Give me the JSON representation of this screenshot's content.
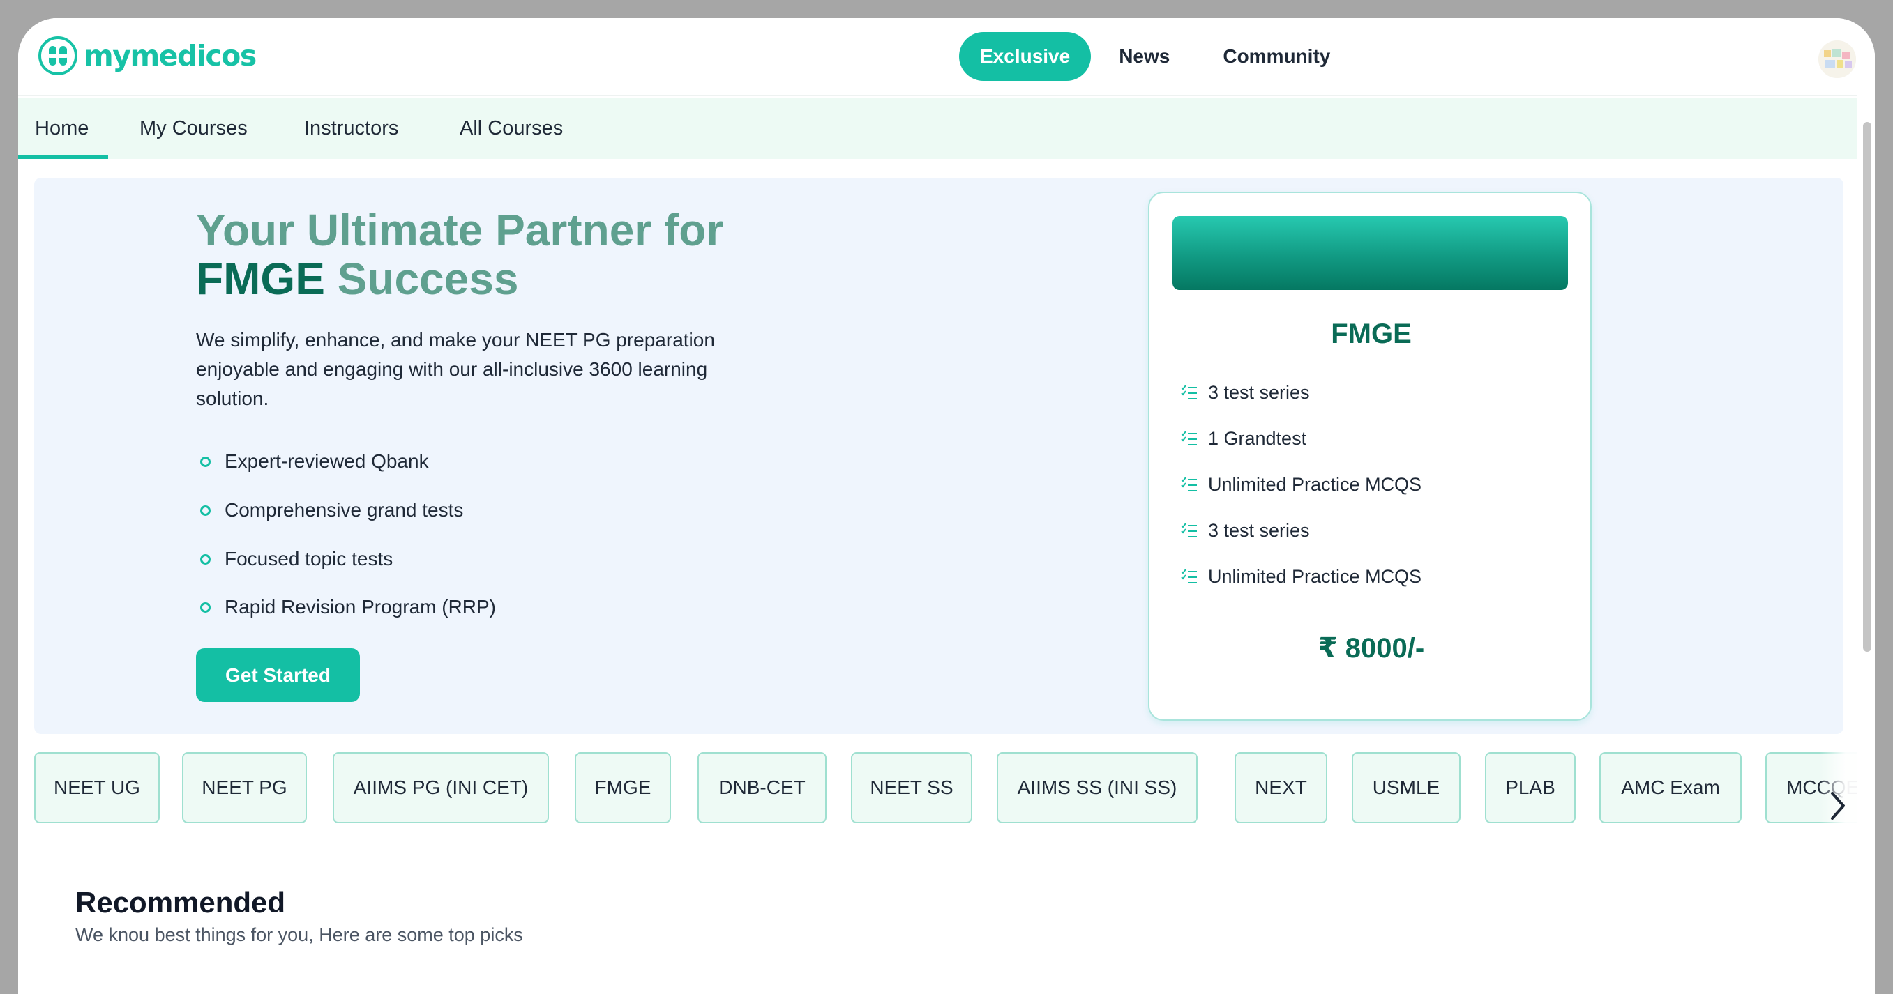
{
  "brand": {
    "name": "mymedicos",
    "color": "#17c2a6"
  },
  "top_nav": [
    {
      "label": "Exclusive",
      "active": true
    },
    {
      "label": "News",
      "active": false
    },
    {
      "label": "Community",
      "active": false
    }
  ],
  "sub_nav": [
    {
      "label": "Home",
      "active": true
    },
    {
      "label": "My Courses",
      "active": false
    },
    {
      "label": "Instructors",
      "active": false
    },
    {
      "label": "All Courses",
      "active": false
    }
  ],
  "hero": {
    "title_line1": "Your Ultimate Partner for",
    "title_em": "FMGE",
    "title_rest": " Success",
    "description": "We simplify, enhance, and make your NEET PG preparation enjoyable and engaging with our all-inclusive 3600 learning solution.",
    "features": [
      "Expert-reviewed Qbank",
      "Comprehensive grand tests",
      "Focused topic tests",
      "Rapid Revision Program (RRP)"
    ],
    "cta_label": "Get Started"
  },
  "plan": {
    "title": "FMGE",
    "items": [
      "3 test series",
      "1 Grandtest",
      "Unlimited Practice MCQS",
      "3 test series",
      "Unlimited Practice MCQS"
    ],
    "price": "₹ 8000/-"
  },
  "exam_chips": [
    "NEET UG",
    "NEET PG",
    "AIIMS PG (INI CET)",
    "FMGE",
    "DNB-CET",
    "NEET SS",
    "AIIMS SS (INI SS)",
    "NEXT",
    "USMLE",
    "PLAB",
    "AMC Exam",
    "MCCQE"
  ],
  "recommended": {
    "title": "Recommended",
    "subtitle": "We knou best things for you, Here are some top picks"
  },
  "colors": {
    "accent": "#14bfa4",
    "dark_green": "#0a6b56",
    "hero_bg": "#eff5fd",
    "subnav_bg": "#edfaf4"
  }
}
